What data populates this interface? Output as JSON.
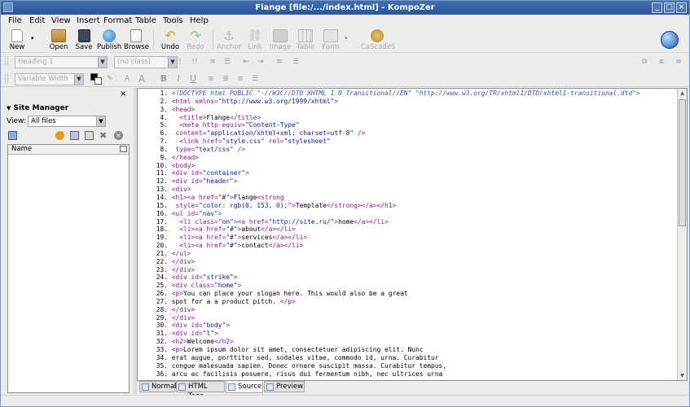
{
  "window": {
    "title": "Flange [file:/.../index.html] - KompoZer",
    "minimize": "_",
    "maximize": "□",
    "close": "×"
  },
  "menu": [
    "File",
    "Edit",
    "View",
    "Insert",
    "Format",
    "Table",
    "Tools",
    "Help"
  ],
  "toolbar": {
    "new": "New",
    "open": "Open",
    "save": "Save",
    "publish": "Publish",
    "browse": "Browse",
    "undo": "Undo",
    "redo": "Redo",
    "anchor": "Anchor",
    "link": "Link",
    "image": "Image",
    "table": "Table",
    "form": "Form",
    "cascades": "CaScadeS"
  },
  "format": {
    "paragraph_style": "Heading 1",
    "class_select": "(no class)",
    "width_select": "Variable Width"
  },
  "site_manager": {
    "title": "Site Manager",
    "view_label": "View:",
    "view_value": "All files",
    "column_name": "Name"
  },
  "code_lines": [
    {
      "n": "1.",
      "s": [
        [
          "c",
          "<!DOCTYPE html PUBLIC \"-//W3C//DTD XHTML 1.0 Transitional//EN\" \"http://www.w3.org/TR/xhtml1/DTD/xhtml1-transitional.dtd\">"
        ]
      ]
    },
    {
      "n": "2.",
      "s": [
        [
          "t",
          "<html "
        ],
        [
          "a",
          "xmlns="
        ],
        [
          "v",
          "\"http://www.w3.org/1999/xhtml\""
        ],
        [
          "t",
          ">"
        ]
      ]
    },
    {
      "n": "3.",
      "s": [
        [
          "t",
          "<head>"
        ]
      ]
    },
    {
      "n": "4.",
      "s": [
        [
          "x",
          "  "
        ],
        [
          "t",
          "<title>"
        ],
        [
          "x",
          "Flange"
        ],
        [
          "t",
          "</title>"
        ]
      ]
    },
    {
      "n": "5.",
      "s": [
        [
          "x",
          "  "
        ],
        [
          "t",
          "<meta "
        ],
        [
          "a",
          "http-equiv="
        ],
        [
          "v",
          "\"Content-Type\""
        ]
      ]
    },
    {
      "n": "6.",
      "s": [
        [
          "x",
          " "
        ],
        [
          "a",
          "content="
        ],
        [
          "v",
          "\"application/xhtml+xml; charset=utf-8\""
        ],
        [
          "t",
          " />"
        ]
      ]
    },
    {
      "n": "7.",
      "s": [
        [
          "x",
          "  "
        ],
        [
          "t",
          "<link "
        ],
        [
          "a",
          "href="
        ],
        [
          "v",
          "\"style.css\""
        ],
        [
          "a",
          " rel="
        ],
        [
          "v",
          "\"stylesheet\""
        ]
      ]
    },
    {
      "n": "8.",
      "s": [
        [
          "x",
          " "
        ],
        [
          "a",
          "type="
        ],
        [
          "v",
          "\"text/css\""
        ],
        [
          "t",
          " />"
        ]
      ]
    },
    {
      "n": "9.",
      "s": [
        [
          "t",
          "</head>"
        ]
      ]
    },
    {
      "n": "10.",
      "s": [
        [
          "t",
          "<body>"
        ]
      ]
    },
    {
      "n": "11.",
      "s": [
        [
          "t",
          "<div "
        ],
        [
          "a",
          "id="
        ],
        [
          "v",
          "\"container\""
        ],
        [
          "t",
          ">"
        ]
      ]
    },
    {
      "n": "12.",
      "s": [
        [
          "t",
          "<div "
        ],
        [
          "a",
          "id="
        ],
        [
          "v",
          "\"header\""
        ],
        [
          "t",
          ">"
        ]
      ]
    },
    {
      "n": "13.",
      "s": [
        [
          "t",
          "<div>"
        ]
      ]
    },
    {
      "n": "14.",
      "s": [
        [
          "t",
          "<h1><a "
        ],
        [
          "a",
          "href="
        ],
        [
          "v",
          "\"#\""
        ],
        [
          "t",
          ">"
        ],
        [
          "x",
          "Flange"
        ],
        [
          "t",
          "<strong"
        ]
      ]
    },
    {
      "n": "15.",
      "s": [
        [
          "x",
          " "
        ],
        [
          "a",
          "style="
        ],
        [
          "v",
          "\"color: rgb(0, 153, 0);\""
        ],
        [
          "t",
          ">"
        ],
        [
          "x",
          "Template"
        ],
        [
          "t",
          "</strong></a></h1>"
        ]
      ]
    },
    {
      "n": "16.",
      "s": [
        [
          "t",
          "<ul "
        ],
        [
          "a",
          "id="
        ],
        [
          "v",
          "\"nav\""
        ],
        [
          "t",
          ">"
        ]
      ]
    },
    {
      "n": "17.",
      "s": [
        [
          "x",
          "  "
        ],
        [
          "t",
          "<li "
        ],
        [
          "a",
          "class="
        ],
        [
          "v",
          "\"on\""
        ],
        [
          "t",
          "><a "
        ],
        [
          "a",
          "href="
        ],
        [
          "v",
          "\"http://site.ru/\""
        ],
        [
          "t",
          ">"
        ],
        [
          "x",
          "home"
        ],
        [
          "t",
          "</a></li>"
        ]
      ]
    },
    {
      "n": "18.",
      "s": [
        [
          "x",
          "  "
        ],
        [
          "t",
          "<li><a "
        ],
        [
          "a",
          "href="
        ],
        [
          "v",
          "\"#\""
        ],
        [
          "t",
          ">"
        ],
        [
          "x",
          "about"
        ],
        [
          "t",
          "</a></li>"
        ]
      ]
    },
    {
      "n": "19.",
      "s": [
        [
          "x",
          "  "
        ],
        [
          "t",
          "<li><a "
        ],
        [
          "a",
          "href="
        ],
        [
          "v",
          "\"#\""
        ],
        [
          "t",
          ">"
        ],
        [
          "x",
          "services"
        ],
        [
          "t",
          "</a></li>"
        ]
      ]
    },
    {
      "n": "20.",
      "s": [
        [
          "x",
          "  "
        ],
        [
          "t",
          "<li><a "
        ],
        [
          "a",
          "href="
        ],
        [
          "v",
          "\"#\""
        ],
        [
          "t",
          ">"
        ],
        [
          "x",
          "contact"
        ],
        [
          "t",
          "</a></li>"
        ]
      ]
    },
    {
      "n": "21.",
      "s": [
        [
          "t",
          "</ul>"
        ]
      ]
    },
    {
      "n": "22.",
      "s": [
        [
          "t",
          "</div>"
        ]
      ]
    },
    {
      "n": "23.",
      "s": [
        [
          "t",
          "</div>"
        ]
      ]
    },
    {
      "n": "24.",
      "s": [
        [
          "t",
          "<div "
        ],
        [
          "a",
          "id="
        ],
        [
          "v",
          "\"strike\""
        ],
        [
          "t",
          ">"
        ]
      ]
    },
    {
      "n": "25.",
      "s": [
        [
          "t",
          "<div "
        ],
        [
          "a",
          "class="
        ],
        [
          "v",
          "\"home\""
        ],
        [
          "t",
          ">"
        ]
      ]
    },
    {
      "n": "26.",
      "s": [
        [
          "t",
          "<p>"
        ],
        [
          "x",
          "You can place your slogan here. This would also be a great"
        ]
      ]
    },
    {
      "n": "27.",
      "s": [
        [
          "x",
          "spot for a a product pitch. "
        ],
        [
          "t",
          "</p>"
        ]
      ]
    },
    {
      "n": "28.",
      "s": [
        [
          "t",
          "</div>"
        ]
      ]
    },
    {
      "n": "29.",
      "s": [
        [
          "t",
          "</div>"
        ]
      ]
    },
    {
      "n": "30.",
      "s": [
        [
          "t",
          "<div "
        ],
        [
          "a",
          "id="
        ],
        [
          "v",
          "\"body\""
        ],
        [
          "t",
          ">"
        ]
      ]
    },
    {
      "n": "31.",
      "s": [
        [
          "t",
          "<div "
        ],
        [
          "a",
          "id="
        ],
        [
          "v",
          "\"l\""
        ],
        [
          "t",
          ">"
        ]
      ]
    },
    {
      "n": "32.",
      "s": [
        [
          "t",
          "<h2>"
        ],
        [
          "x",
          "Welcome"
        ],
        [
          "t",
          "</h2>"
        ]
      ]
    },
    {
      "n": "33.",
      "s": [
        [
          "t",
          "<p>"
        ],
        [
          "x",
          "Lorem ipsum dolor sit amet, consectetuer adipiscing elit. Nunc"
        ]
      ]
    },
    {
      "n": "34.",
      "s": [
        [
          "x",
          "erat augue, porttitor sed, sodales vitae, commodo id, urna. Curabitur"
        ]
      ]
    },
    {
      "n": "35.",
      "s": [
        [
          "x",
          "congue malesuada sapien. Donec ornare suscipit massa. Curabitur tempus,"
        ]
      ]
    },
    {
      "n": "36.",
      "s": [
        [
          "x",
          "arcu ac facilisis posuere, risus dui fermentum nibh, nec ultrices urna"
        ]
      ]
    }
  ],
  "mode_tabs": [
    "Normal",
    "HTML Tags",
    "Source",
    "Preview"
  ],
  "colors": {
    "tag": "#851b89",
    "value": "#0a1b99",
    "titlebar": "#2f5d9f"
  },
  "icons": [
    "new-icon",
    "open-icon",
    "save-icon",
    "publish-icon",
    "browse-icon",
    "undo-icon",
    "redo-icon",
    "anchor-icon",
    "link-icon",
    "image-icon",
    "table-icon",
    "form-icon",
    "cascades-icon",
    "globe-icon"
  ]
}
